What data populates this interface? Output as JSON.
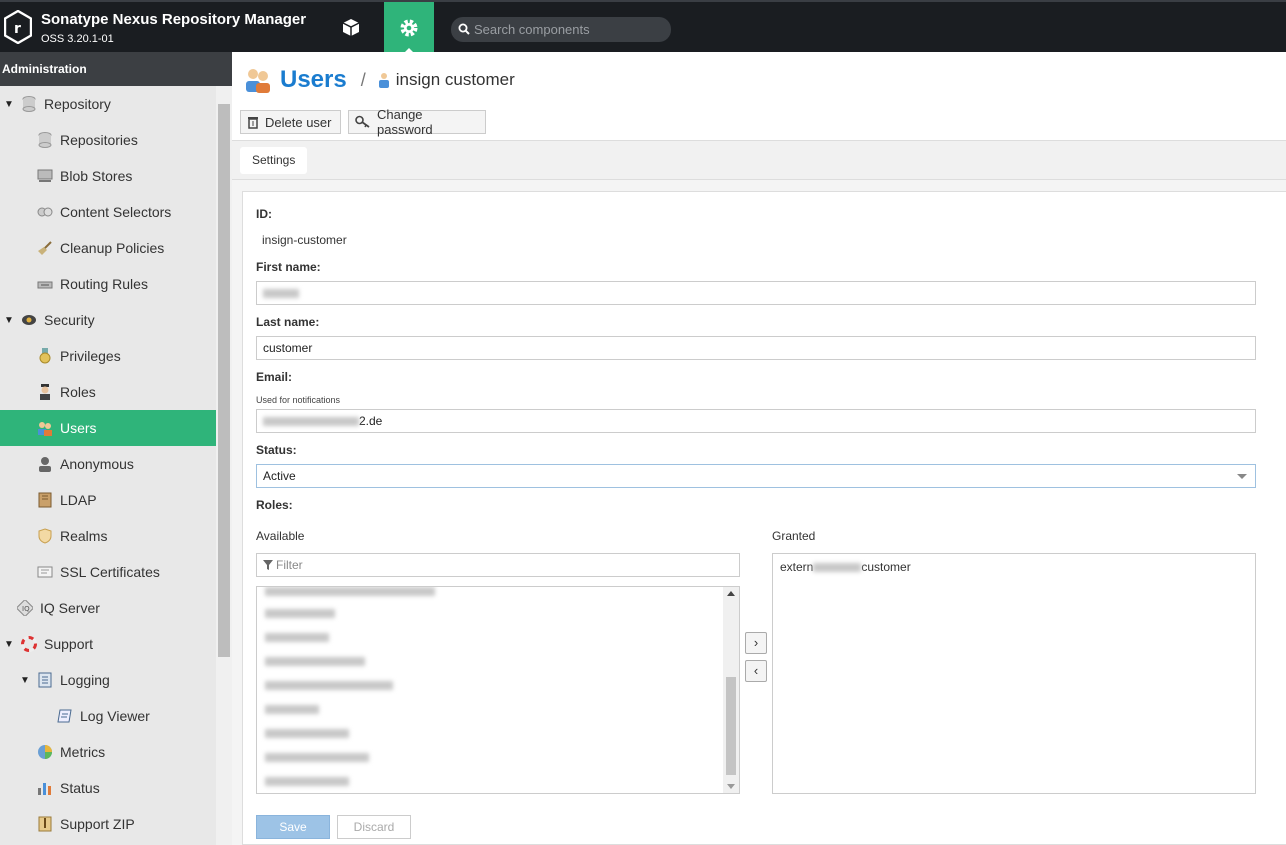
{
  "app": {
    "title": "Sonatype Nexus Repository Manager",
    "version": "OSS 3.20.1-01"
  },
  "topbar": {
    "search_placeholder": "Search components"
  },
  "sidebar": {
    "header": "Administration",
    "items": [
      {
        "label": "Repository",
        "icon": "database-icon",
        "level": 0,
        "expanded": true
      },
      {
        "label": "Repositories",
        "icon": "database-icon",
        "level": 1
      },
      {
        "label": "Blob Stores",
        "icon": "server-icon",
        "level": 1
      },
      {
        "label": "Content Selectors",
        "icon": "selector-icon",
        "level": 1
      },
      {
        "label": "Cleanup Policies",
        "icon": "broom-icon",
        "level": 1
      },
      {
        "label": "Routing Rules",
        "icon": "router-icon",
        "level": 1
      },
      {
        "label": "Security",
        "icon": "security-icon",
        "level": 0,
        "expanded": true
      },
      {
        "label": "Privileges",
        "icon": "medal-icon",
        "level": 1
      },
      {
        "label": "Roles",
        "icon": "role-icon",
        "level": 1
      },
      {
        "label": "Users",
        "icon": "users-icon",
        "level": 1,
        "active": true
      },
      {
        "label": "Anonymous",
        "icon": "anonymous-icon",
        "level": 1
      },
      {
        "label": "LDAP",
        "icon": "ldap-book-icon",
        "level": 1
      },
      {
        "label": "Realms",
        "icon": "shield-icon",
        "level": 1
      },
      {
        "label": "SSL Certificates",
        "icon": "certificate-icon",
        "level": 1
      },
      {
        "label": "IQ Server",
        "icon": "iq-server-icon",
        "level": 0
      },
      {
        "label": "Support",
        "icon": "lifebuoy-icon",
        "level": 0,
        "expanded": true
      },
      {
        "label": "Logging",
        "icon": "logging-icon",
        "level": 1,
        "expanded": true
      },
      {
        "label": "Log Viewer",
        "icon": "log-viewer-icon",
        "level": 2
      },
      {
        "label": "Metrics",
        "icon": "pie-chart-icon",
        "level": 1
      },
      {
        "label": "Status",
        "icon": "bar-chart-icon",
        "level": 1
      },
      {
        "label": "Support ZIP",
        "icon": "zip-icon",
        "level": 1
      }
    ]
  },
  "breadcrumb": {
    "title": "Users",
    "separator": "/",
    "current": "insign customer"
  },
  "toolbar": {
    "delete_label": "Delete user",
    "change_password_label": "Change password"
  },
  "tabs": [
    {
      "label": "Settings"
    }
  ],
  "form": {
    "id_label": "ID:",
    "id_value": "insign-customer",
    "first_name_label": "First name:",
    "last_name_label": "Last name:",
    "last_name_value": "customer",
    "email_label": "Email:",
    "email_help": "Used for notifications",
    "email_suffix": "2.de",
    "status_label": "Status:",
    "status_value": "Active",
    "roles_label": "Roles:",
    "available_label": "Available",
    "granted_label": "Granted",
    "filter_placeholder": "Filter",
    "granted_prefix": "extern",
    "granted_suffix": "customer",
    "save_label": "Save",
    "discard_label": "Discard"
  },
  "colors": {
    "accent": "#2fb47a",
    "link": "#1a7ccf",
    "topbar": "#1a1d21",
    "save": "#9dc3e6"
  }
}
